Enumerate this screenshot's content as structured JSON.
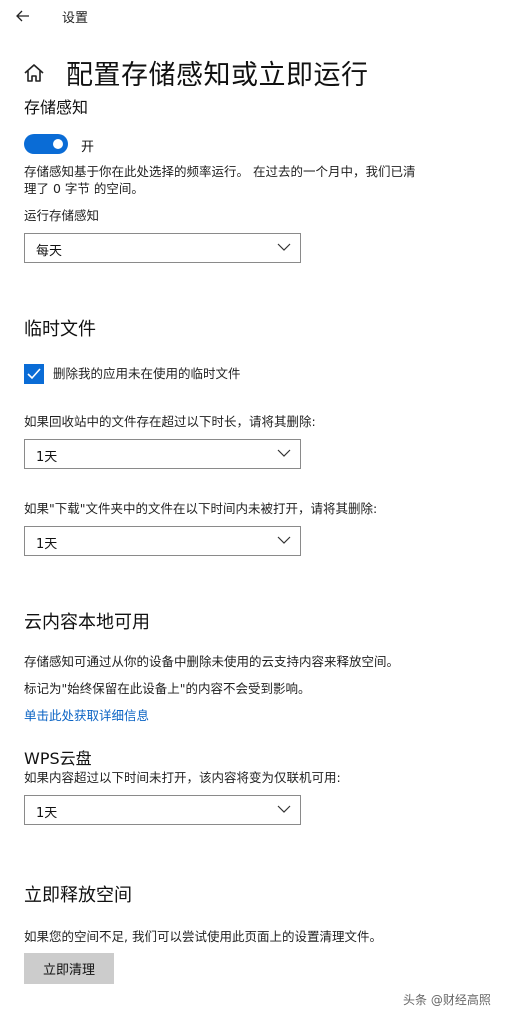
{
  "topbar": {
    "title": "设置"
  },
  "page": {
    "title": "配置存储感知或立即运行"
  },
  "storage_sense": {
    "heading": "存储感知",
    "toggle_label": "开",
    "toggle_on": true,
    "desc_line1": "存储感知基于你在此处选择的频率运行。 在过去的一个月中，我们已清",
    "desc_line2": "理了 0 字节 的空间。",
    "run_label": "运行存储感知",
    "run_value": "每天"
  },
  "temp_files": {
    "heading": "临时文件",
    "checkbox_label": "删除我的应用未在使用的临时文件",
    "checkbox_checked": true,
    "recycle_label": "如果回收站中的文件存在超过以下时长，请将其删除:",
    "recycle_value": "1天",
    "downloads_label": "如果\"下载\"文件夹中的文件在以下时间内未被打开，请将其删除:",
    "downloads_value": "1天"
  },
  "cloud": {
    "heading": "云内容本地可用",
    "desc1": "存储感知可通过从你的设备中删除未使用的云支持内容来释放空间。",
    "desc2": "标记为\"始终保留在此设备上\"的内容不会受到影响。",
    "link": "单击此处获取详细信息",
    "provider": "WPS云盘",
    "provider_label": "如果内容超过以下时间未打开，该内容将变为仅联机可用:",
    "provider_value": "1天"
  },
  "free_now": {
    "heading": "立即释放空间",
    "desc": "如果您的空间不足, 我们可以尝试使用此页面上的设置清理文件。",
    "button": "立即清理"
  },
  "watermark": "头条 @财经高照",
  "colors": {
    "accent": "#0a6cd6",
    "link": "#0a63c4",
    "button_bg": "#cccccc"
  }
}
